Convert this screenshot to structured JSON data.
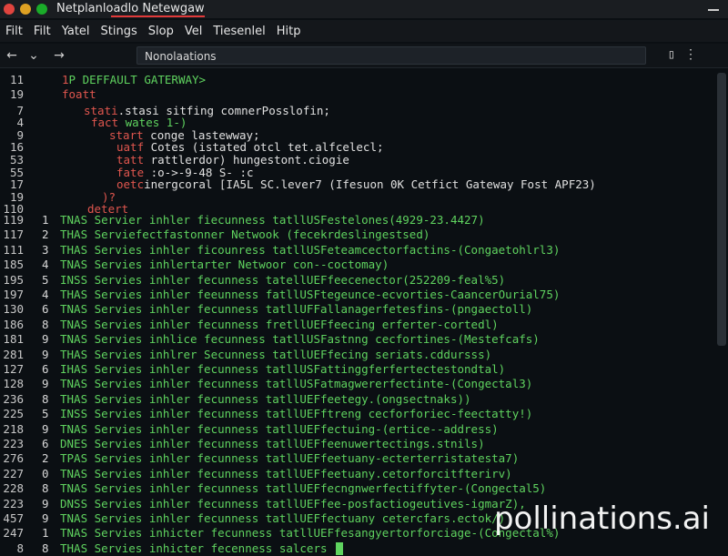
{
  "window": {
    "title": "Netplanloadlo Netewgaw"
  },
  "menu": [
    "Filt",
    "Filt",
    "Yatel",
    "Stings",
    "Slop",
    "Vel",
    "Tiesenlel",
    "Hitp"
  ],
  "toolbar": {
    "back": "←",
    "dropdown": "⌄",
    "forward": "→",
    "tab_title": "Nonolaations",
    "copy_icon": "▯",
    "more_icon": "⋮"
  },
  "editor": {
    "header_lines": [
      {
        "ln": "11",
        "indent": 68,
        "parts": [
          {
            "c": "r",
            "t": "1"
          },
          {
            "c": "g",
            "t": "P DEFFAULT GATERWAY>"
          }
        ]
      },
      {
        "ln": "19",
        "indent": 68,
        "parts": [
          {
            "c": "r",
            "t": "foatt"
          }
        ]
      },
      {
        "ln": "7",
        "indent": 92,
        "parts": [
          {
            "c": "r",
            "t": "stati"
          },
          {
            "c": "w",
            "t": ".stasi sitfing comnerPosslofin;"
          }
        ]
      },
      {
        "ln": "4",
        "indent": 100,
        "parts": [
          {
            "c": "r",
            "t": "fact"
          },
          {
            "c": "g",
            "t": " wates 1-)"
          }
        ]
      },
      {
        "ln": "9",
        "indent": 120,
        "parts": [
          {
            "c": "r",
            "t": "start"
          },
          {
            "c": "w",
            "t": " conge lastewway;"
          }
        ]
      },
      {
        "ln": "16",
        "indent": 128,
        "parts": [
          {
            "c": "r",
            "t": "uatf"
          },
          {
            "c": "w",
            "t": " Cotes (istated otcl tet.alfcelecl;"
          }
        ]
      },
      {
        "ln": "53",
        "indent": 128,
        "parts": [
          {
            "c": "r",
            "t": "tatt"
          },
          {
            "c": "w",
            "t": " rattlerdor) hungestont.ciogie"
          }
        ]
      },
      {
        "ln": "55",
        "indent": 128,
        "parts": [
          {
            "c": "r",
            "t": "fate"
          },
          {
            "c": "w",
            "t": " :o->-9-48 S- :c"
          }
        ]
      },
      {
        "ln": "17",
        "indent": 128,
        "parts": [
          {
            "c": "r",
            "t": "oetc"
          },
          {
            "c": "w",
            "t": "inergcoral [IA5L SC.lever7 (Ifesuon 0K Cetfict Gateway Fost APF23)"
          }
        ]
      },
      {
        "ln": "19",
        "indent": 112,
        "parts": [
          {
            "c": "r",
            "t": ")?"
          }
        ]
      },
      {
        "ln": "110",
        "indent": 96,
        "parts": [
          {
            "c": "r",
            "t": "detert"
          }
        ]
      }
    ],
    "rows": [
      {
        "ln": "119",
        "idx": "1",
        "text": "TNAS Servier inhler fiecunness tatllUSFestelones(4929-23.4427)"
      },
      {
        "ln": "117",
        "idx": "2",
        "text": "THAS Serviefectfastonner Netwook (fecekrdeslingestsed)"
      },
      {
        "ln": "111",
        "idx": "3",
        "text": "THAS Servies inhler ficounress tatllUSFeteamcectorfactins-(Congaetohlrl3)"
      },
      {
        "ln": "185",
        "idx": "4",
        "text": "TNAS Servies inhlertarter Netwoor con--coctomay)"
      },
      {
        "ln": "195",
        "idx": "5",
        "text": "INSS Servies inhler fecunness tatellUEFfeecenector(252209-feal%5)"
      },
      {
        "ln": "197",
        "idx": "4",
        "text": "THAS Servies inhler feeunness fatllUSFtegeunce-ecvorties-CaancerOurial75)"
      },
      {
        "ln": "130",
        "idx": "6",
        "text": "TNAS Servies inhler fecunness tatllUFFallanagerfetesfins-(pngaectoll)"
      },
      {
        "ln": "186",
        "idx": "8",
        "text": "TNAS Servies inhler fecunness fretllUEFfeecing erferter-cortedl)"
      },
      {
        "ln": "181",
        "idx": "9",
        "text": "TNAS Servies inhlice fecunness tatllUSFastnng cecfortines-(Mestefcafs)"
      },
      {
        "ln": "281",
        "idx": "9",
        "text": "THAS Servies inhlrer Secunness tatllUEFfecing seriats.cddursss)"
      },
      {
        "ln": "127",
        "idx": "6",
        "text": "IHAS Servies inhler fecunness tatllUSFattinggferfertectestondtal)"
      },
      {
        "ln": "128",
        "idx": "9",
        "text": "TNAS Servies inhler fecunness tatllUSFatmagwererfectinte-(Congectal3)"
      },
      {
        "ln": "236",
        "idx": "8",
        "text": "THAS Servies inhler fecunness tatllUEFfeetegy.(ongsectnaks))"
      },
      {
        "ln": "225",
        "idx": "5",
        "text": "INSS Servies inhler fecunness tatllUEFftreng cecforforiec-feectatty!)"
      },
      {
        "ln": "218",
        "idx": "9",
        "text": "TNAS Servies inhler fecunness tatllUEFfectuing-(ertice--address)"
      },
      {
        "ln": "223",
        "idx": "6",
        "text": "DNES Servies inhler fecunness tatllUEFfeenuwertectings.stnils)"
      },
      {
        "ln": "276",
        "idx": "2",
        "text": "TPAS Servies inhler fecunness tatllUEFfeetuany-ecterterristatesta7)"
      },
      {
        "ln": "227",
        "idx": "0",
        "text": "TNAS Servies inhler fecunness tatllUEFfeetuany.cetorforcitfterirv)"
      },
      {
        "ln": "228",
        "idx": "8",
        "text": "TNAS Servies inhler fecunness tatllUEFfecngnwerfectiffyter-(Congectal5)"
      },
      {
        "ln": "223",
        "idx": "9",
        "text": "DNSS Servies inhler fecunness tatllUEFfee-posfactiogeutives-igmarZ),"
      },
      {
        "ln": "457",
        "idx": "9",
        "text": "TNAS Servies inhler fecunness tatllUEFfectuany cetercfars.ectok/)"
      },
      {
        "ln": "247",
        "idx": "1",
        "text": "TNAS Servies inhicter fecunness tatllUEFfesangyertorforciage-(Congectal%)"
      },
      {
        "ln": "8",
        "idx": "8",
        "text": "THAS Servies inhicter fecenness salcers"
      }
    ]
  },
  "watermark": "pollinations.ai",
  "colors": {
    "green": "#5fd35f",
    "red": "#e0564e",
    "bg": "#0b0f13"
  }
}
